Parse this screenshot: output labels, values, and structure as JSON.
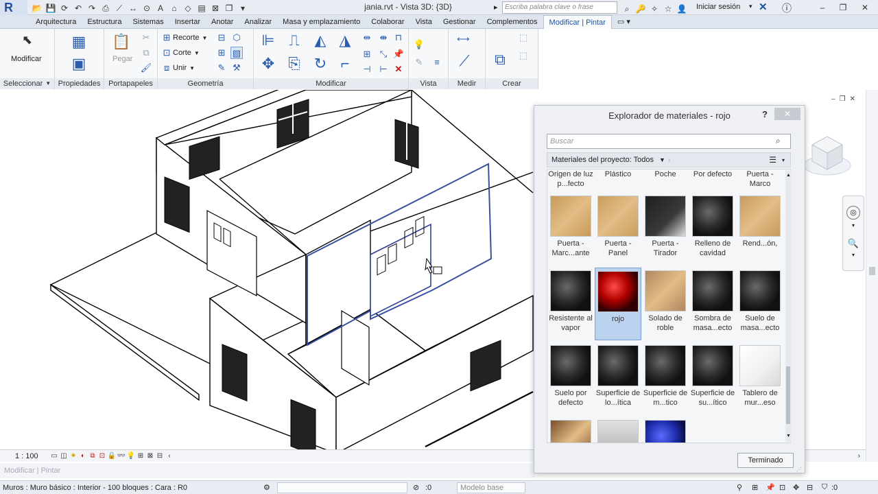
{
  "titlebar": {
    "app_logo": "R",
    "doc_title": "jania.rvt - Vista 3D: {3D}",
    "search_placeholder": "Escriba palabra clave o frase",
    "signin_label": "Iniciar sesión",
    "qat_icons": [
      "open-icon",
      "save-icon",
      "sync-icon",
      "undo-icon",
      "redo-icon",
      "measure-icon",
      "dimension-icon",
      "text-icon",
      "3d-view-icon",
      "section-icon",
      "close-hidden-icon",
      "switch-windows-icon"
    ]
  },
  "tabs": [
    "Arquitectura",
    "Estructura",
    "Sistemas",
    "Insertar",
    "Anotar",
    "Analizar",
    "Masa y emplazamiento",
    "Colaborar",
    "Vista",
    "Gestionar",
    "Complementos",
    "Modificar | Pintar"
  ],
  "ribbon": {
    "modify_label": "Modificar",
    "paste_label": "Pegar",
    "cut_label": "Recorte",
    "corte_label": "Corte",
    "join_label": "Unir",
    "panels": [
      "Seleccionar",
      "Propiedades",
      "Portapapeles",
      "Geometría",
      "Modificar",
      "Vista",
      "Medir",
      "Crear"
    ]
  },
  "view_control": {
    "scale": "1 : 100"
  },
  "modify_bar": {
    "label": "Modificar | Pintar"
  },
  "statusbar": {
    "text": "Muros : Muro básico : Interior - 100 bloques : Cara : R0",
    "workset_value": ":0",
    "design_option": "Modelo base",
    "filter_value": ":0"
  },
  "material_browser": {
    "title": "Explorador de materiales - rojo",
    "help": "?",
    "search_placeholder": "Buscar",
    "breadcrumb": "Materiales del proyecto: Todos",
    "done_label": "Terminado",
    "header_row": [
      {
        "label": "Origen de luz p...fecto"
      },
      {
        "label": "Plástico"
      },
      {
        "label": "Poche"
      },
      {
        "label": "Por defecto"
      },
      {
        "label": "Puerta - Marco"
      }
    ],
    "materials": [
      {
        "label": "Puerta - Marc...ante",
        "swatch": "#c79a5a",
        "kind": "wood"
      },
      {
        "label": "Puerta - Panel",
        "swatch": "#c99d5e",
        "kind": "wood"
      },
      {
        "label": "Puerta - Tirador",
        "swatch": "#2a2a2a",
        "kind": "dark"
      },
      {
        "label": "Relleno de cavidad",
        "swatch": "#2e2e2e",
        "kind": "sphere"
      },
      {
        "label": "Rend...ón,",
        "swatch": "#c89a60",
        "kind": "wood"
      },
      {
        "label": "Resistente al vapor",
        "swatch": "#2b2b2b",
        "kind": "sphere"
      },
      {
        "label": "rojo",
        "swatch": "#b00000",
        "kind": "red-sphere",
        "selected": true
      },
      {
        "label": "Solado de roble",
        "swatch": "#b08660",
        "kind": "wood"
      },
      {
        "label": "Sombra de masa...ecto",
        "swatch": "#2c2c2c",
        "kind": "sphere"
      },
      {
        "label": "Suelo de masa...ecto",
        "swatch": "#2c2c2c",
        "kind": "sphere"
      },
      {
        "label": "Suelo por defecto",
        "swatch": "#2b2b2b",
        "kind": "sphere"
      },
      {
        "label": "Superficie de lo...ítica",
        "swatch": "#2c2c2c",
        "kind": "sphere"
      },
      {
        "label": "Superficie de m...tico",
        "swatch": "#2c2c2c",
        "kind": "sphere"
      },
      {
        "label": "Superficie de su...ítico",
        "swatch": "#2c2c2c",
        "kind": "sphere"
      },
      {
        "label": "Tablero de mur...eso",
        "swatch": "#f2f2f2",
        "kind": "white-cube"
      },
      {
        "label": "",
        "swatch": "#7a4e2c",
        "kind": "wood"
      },
      {
        "label": "",
        "swatch": "#bfbfbf",
        "kind": "gray"
      },
      {
        "label": "",
        "swatch": "#1c2aa8",
        "kind": "blue-sphere"
      }
    ]
  }
}
